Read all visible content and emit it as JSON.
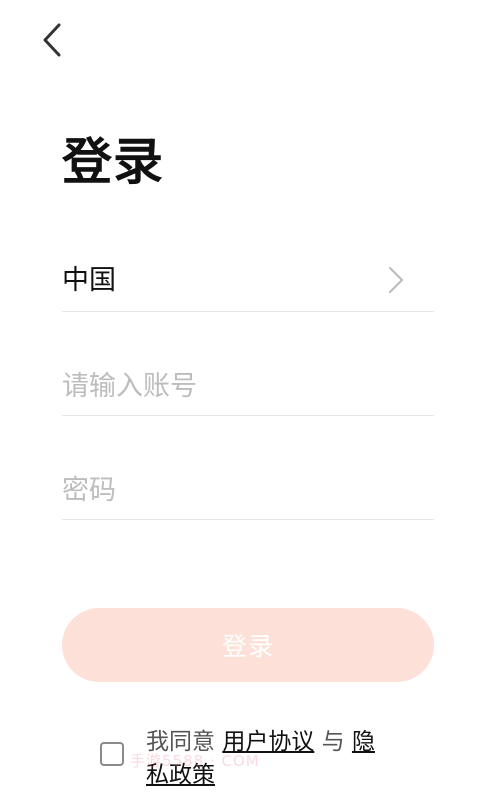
{
  "header": {
    "back_icon": "chevron-left-icon",
    "title": "登录"
  },
  "form": {
    "region": {
      "value": "中国",
      "chevron_icon": "chevron-right-icon"
    },
    "account": {
      "placeholder": "请输入账号",
      "value": ""
    },
    "password": {
      "placeholder": "密码",
      "value": ""
    },
    "login_button_label": "登录"
  },
  "agreement": {
    "checked": false,
    "prefix": "我同意",
    "user_agreement_link": "用户协议",
    "conjunction": "与",
    "privacy_policy_link": "隐私政策"
  },
  "watermark": "手游5588 · COM",
  "colors": {
    "login_button_bg": "#fde0d7",
    "login_button_text": "#ffffff",
    "placeholder": "#bdbdbd",
    "divider": "#e6e6e6",
    "title": "#111111"
  }
}
